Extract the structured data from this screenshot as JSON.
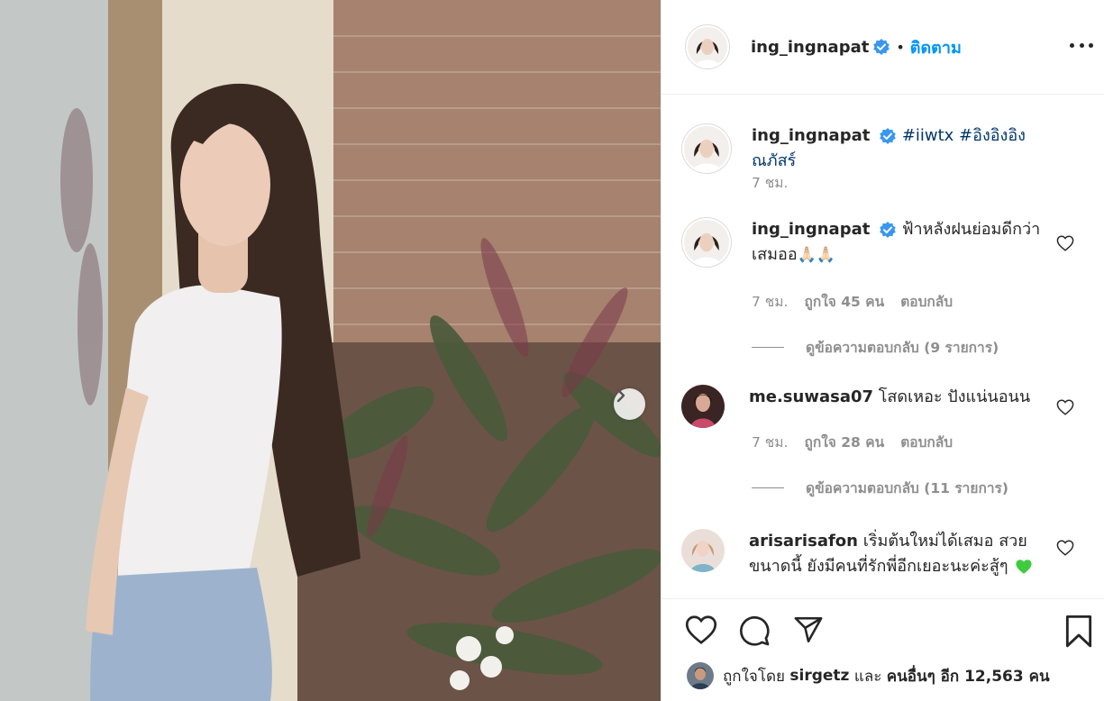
{
  "post": {
    "username": "ing_ingnapat",
    "follow_label": "ติดตาม",
    "separator": "•"
  },
  "caption": {
    "username": "ing_ingnapat",
    "hashtags": "#iiwtx #อิงอิงอิงณภัสร์",
    "time": "7 ชม."
  },
  "comments": [
    {
      "username": "ing_ingnapat",
      "text": "ฟ้าหลังฝนย่อมดีกว่าเสมออ",
      "emoji": "🙏🏻🙏🏻",
      "time": "7 ชม.",
      "likes": "ถูกใจ 45 คน",
      "reply_label": "ตอบกลับ",
      "view_replies": "ดูข้อความตอบกลับ (9 รายการ)"
    },
    {
      "username": "me.suwasa07",
      "text": "โสดเหอะ ปังแน่นอนน",
      "time": "7 ชม.",
      "likes": "ถูกใจ 28 คน",
      "reply_label": "ตอบกลับ",
      "view_replies": "ดูข้อความตอบกลับ (11 รายการ)"
    },
    {
      "username": "arisarisafon",
      "text": "เริ่มต้นใหม่ได้เสมอ สวยขนาดนี้ ยังมีคนที่รักพี่อีกเยอะนะค่ะสู้ๆ"
    }
  ],
  "likes_bar": {
    "prefix": "ถูกใจโดย",
    "user": "sirgetz",
    "and": "และ",
    "others": "คนอื่นๆ อีก 12,563 คน"
  },
  "icons": {
    "verified": "verified-badge-icon",
    "more": "more-options-icon",
    "next": "chevron-right-icon",
    "like": "heart-icon",
    "comment": "comment-icon",
    "share": "paper-plane-icon",
    "save": "bookmark-icon"
  },
  "colors": {
    "accent": "#0095f6",
    "verified": "#3897f0",
    "text": "#262626",
    "muted": "#8e8e8e",
    "hashtag": "#00376b"
  }
}
